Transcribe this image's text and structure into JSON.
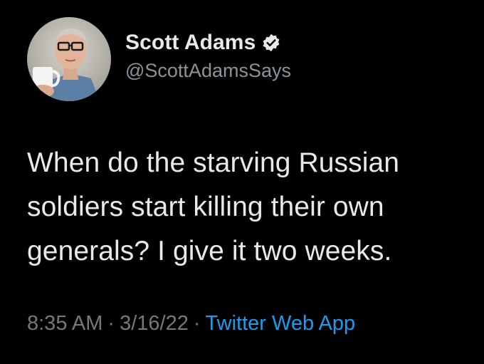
{
  "tweet": {
    "display_name": "Scott Adams",
    "handle": "@ScottAdamsSays",
    "verified_icon": "verified-badge-icon",
    "text": "When do the starving Russian soldiers start killing their own generals? I give it two weeks.",
    "time": "8:35 AM",
    "separator": "·",
    "date": "3/16/22",
    "source": "Twitter Web App"
  },
  "colors": {
    "background": "#000000",
    "primary_text": "#e7e9ea",
    "secondary_text": "#8b949b",
    "link": "#1d9bf0"
  }
}
